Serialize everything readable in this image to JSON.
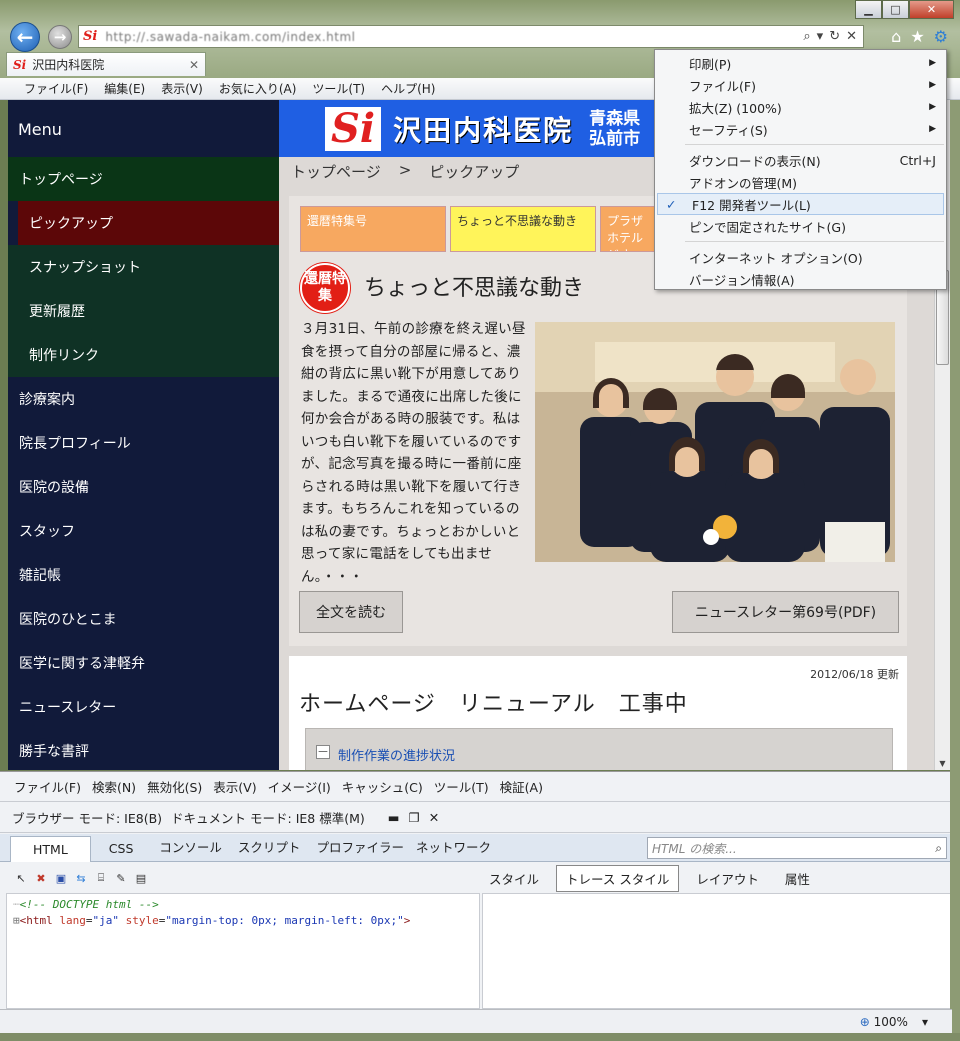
{
  "browser": {
    "tab_title": "沢田内科医院",
    "favicon_label": "Si",
    "url": "http://.sawada-naikam.com/index.html",
    "window_controls": {
      "minimize": "▁",
      "maximize": "□",
      "close": "✕"
    }
  },
  "menubar": [
    "ファイル(F)",
    "編集(E)",
    "表示(V)",
    "お気に入り(A)",
    "ツール(T)",
    "ヘルプ(H)"
  ],
  "sidebar": {
    "header": "Menu",
    "items": [
      {
        "label": "トップページ",
        "kind": "top"
      },
      {
        "label": "ピックアップ",
        "kind": "sel"
      },
      {
        "label": "スナップショット",
        "kind": "sub"
      },
      {
        "label": "更新履歴",
        "kind": "sub"
      },
      {
        "label": "制作リンク",
        "kind": "sub"
      },
      {
        "label": "診療案内",
        "kind": "normal"
      },
      {
        "label": "院長プロフィール",
        "kind": "normal"
      },
      {
        "label": "医院の設備",
        "kind": "normal"
      },
      {
        "label": "スタッフ",
        "kind": "normal"
      },
      {
        "label": "雑記帳",
        "kind": "normal"
      },
      {
        "label": "医院のひとこま",
        "kind": "normal"
      },
      {
        "label": "医学に関する津軽弁",
        "kind": "normal"
      },
      {
        "label": "ニュースレター",
        "kind": "normal"
      },
      {
        "label": "勝手な書評",
        "kind": "normal"
      }
    ]
  },
  "banner": {
    "logo": "Si",
    "title": "沢田内科医院",
    "location_line1": "青森県",
    "location_line2": "弘前市"
  },
  "breadcrumb": {
    "home": "トップページ",
    "sep": ">",
    "current": "ピックアップ"
  },
  "pickup": {
    "tabs": [
      "還暦特集号",
      "ちょっと不思議な動き",
      "プラザホテルジオ"
    ],
    "badge": "還暦特集",
    "title": "ちょっと不思議な動き",
    "text": "３月31日、午前の診療を終え遅い昼食を摂って自分の部屋に帰ると、濃紺の背広に黒い靴下が用意してありました。まるで通夜に出席した後に何か会合がある時の服装です。私はいつも白い靴下を履いているのですが、記念写真を撮る時に一番前に座らされる時は黒い靴下を履いて行きます。もちろんこれを知っているのは私の妻です。ちょっとおかしいと思って家に電話をしても出ません。・・・",
    "read_more": "全文を読む",
    "newsletter": "ニュースレター第69号(PDF)"
  },
  "update": {
    "date": "2012/06/18 更新",
    "title": "ホームページ　リニューアル　工事中",
    "toggle": "－",
    "progress_link": "制作作業の進捗状況"
  },
  "gear_menu": [
    {
      "label": "印刷(P)",
      "arrow": "▶"
    },
    {
      "label": "ファイル(F)",
      "arrow": "▶"
    },
    {
      "label": "拡大(Z) (100%)",
      "arrow": "▶"
    },
    {
      "label": "セーフティ(S)",
      "arrow": "▶"
    },
    {
      "sep": true
    },
    {
      "label": "ダウンロードの表示(N)",
      "shortcut": "Ctrl+J"
    },
    {
      "label": "アドオンの管理(M)"
    },
    {
      "label": "F12 開発者ツール(L)",
      "checked": true
    },
    {
      "label": "ピンで固定されたサイト(G)"
    },
    {
      "sep": true
    },
    {
      "label": "インターネット オプション(O)"
    },
    {
      "label": "バージョン情報(A)"
    }
  ],
  "devtools": {
    "menu": [
      "ファイル(F)",
      "検索(N)",
      "無効化(S)",
      "表示(V)",
      "イメージ(I)",
      "キャッシュ(C)",
      "ツール(T)",
      "検証(A)"
    ],
    "browser_mode": "ブラウザー モード: IE8(B)",
    "document_mode": "ドキュメント モード: IE8 標準(M)",
    "tabs": [
      "HTML",
      "CSS",
      "コンソール",
      "スクリプト",
      "プロファイラー",
      "ネットワーク"
    ],
    "search_placeholder": "HTML の検索...",
    "right_tabs": [
      "スタイル",
      "トレース スタイル",
      "レイアウト",
      "属性"
    ],
    "tree_comment": "<!-- DOCTYPE html -->",
    "tree_html_tag": "<html",
    "tree_attr1": "lang",
    "tree_val1": "\"ja\"",
    "tree_attr2": "style",
    "tree_val2": "\"margin-top: 0px; margin-left: 0px;\"",
    "tree_close": ">"
  },
  "status": {
    "zoom": "100%"
  }
}
